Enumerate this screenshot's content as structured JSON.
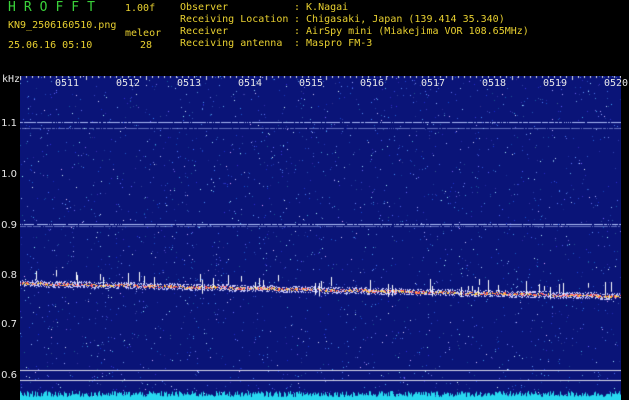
{
  "header": {
    "app_title": "HROFFT",
    "version": "1.00f",
    "filename": "KN9_2506160510.png",
    "datetime": "25.06.16 05:10",
    "counter_label": "meleor",
    "counter_value": "28"
  },
  "info": [
    {
      "key": "Observer",
      "value": ": K.Nagai"
    },
    {
      "key": "Receiving Location",
      "value": ": Chigasaki, Japan (139.414 35.340)"
    },
    {
      "key": "Receiver",
      "value": ": AirSpy mini (Miakejima VOR 108.65MHz)"
    },
    {
      "key": "Receiving antenna",
      "value": ": Maspro FM-3"
    }
  ],
  "spectrogram": {
    "unit": "kHz",
    "y_ticks": [
      "1.1",
      "1.0",
      "0.9",
      "0.8",
      "0.7",
      "0.6"
    ],
    "time_ticks": [
      "0511",
      "0512",
      "0513",
      "0514",
      "0515",
      "0516",
      "0517",
      "0518",
      "0519",
      "0520"
    ],
    "colors": {
      "background": "#0a1478",
      "trace": "#ff5050",
      "noise_floor": "#28d8f0",
      "lines": "#b8c8ff"
    }
  }
}
